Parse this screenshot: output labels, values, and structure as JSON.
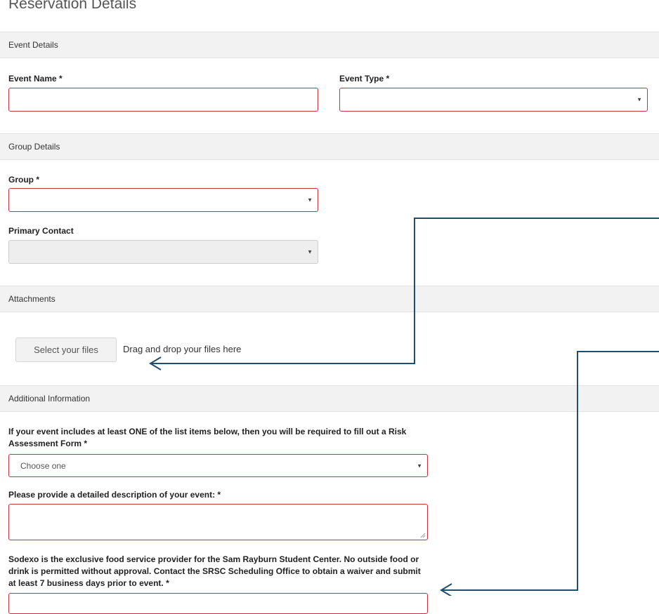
{
  "page": {
    "title": "Reservation Details"
  },
  "event_details": {
    "header": "Event Details",
    "event_name_label": "Event Name *",
    "event_name_value": "",
    "event_type_label": "Event Type *",
    "event_type_value": ""
  },
  "group_details": {
    "header": "Group Details",
    "group_label": "Group *",
    "group_value": "",
    "primary_contact_label": "Primary Contact",
    "primary_contact_value": ""
  },
  "attachments": {
    "header": "Attachments",
    "select_button": "Select your files",
    "drop_hint": "Drag and drop your files here"
  },
  "additional_info": {
    "header": "Additional Information",
    "risk_question": "If your event includes at least ONE of the list items below, then you will be required to fill out a Risk Assessment Form *",
    "risk_select_value": "Choose one",
    "description_label": "Please provide a detailed description of your event: *",
    "description_value": "",
    "food_notice": "Sodexo is the exclusive food service provider for the Sam Rayburn Student Center. No outside food or drink is permitted without approval. Contact the SRSC Scheduling Office to obtain a waiver and submit at least 7 business days prior to event. *"
  },
  "colors": {
    "required_border": "#c9303f",
    "section_bg": "#f2f2f2",
    "arrow": "#1f4e6e"
  },
  "icons": {
    "dropdown": "caret-down-icon",
    "arrow": "arrow-left-icon"
  }
}
